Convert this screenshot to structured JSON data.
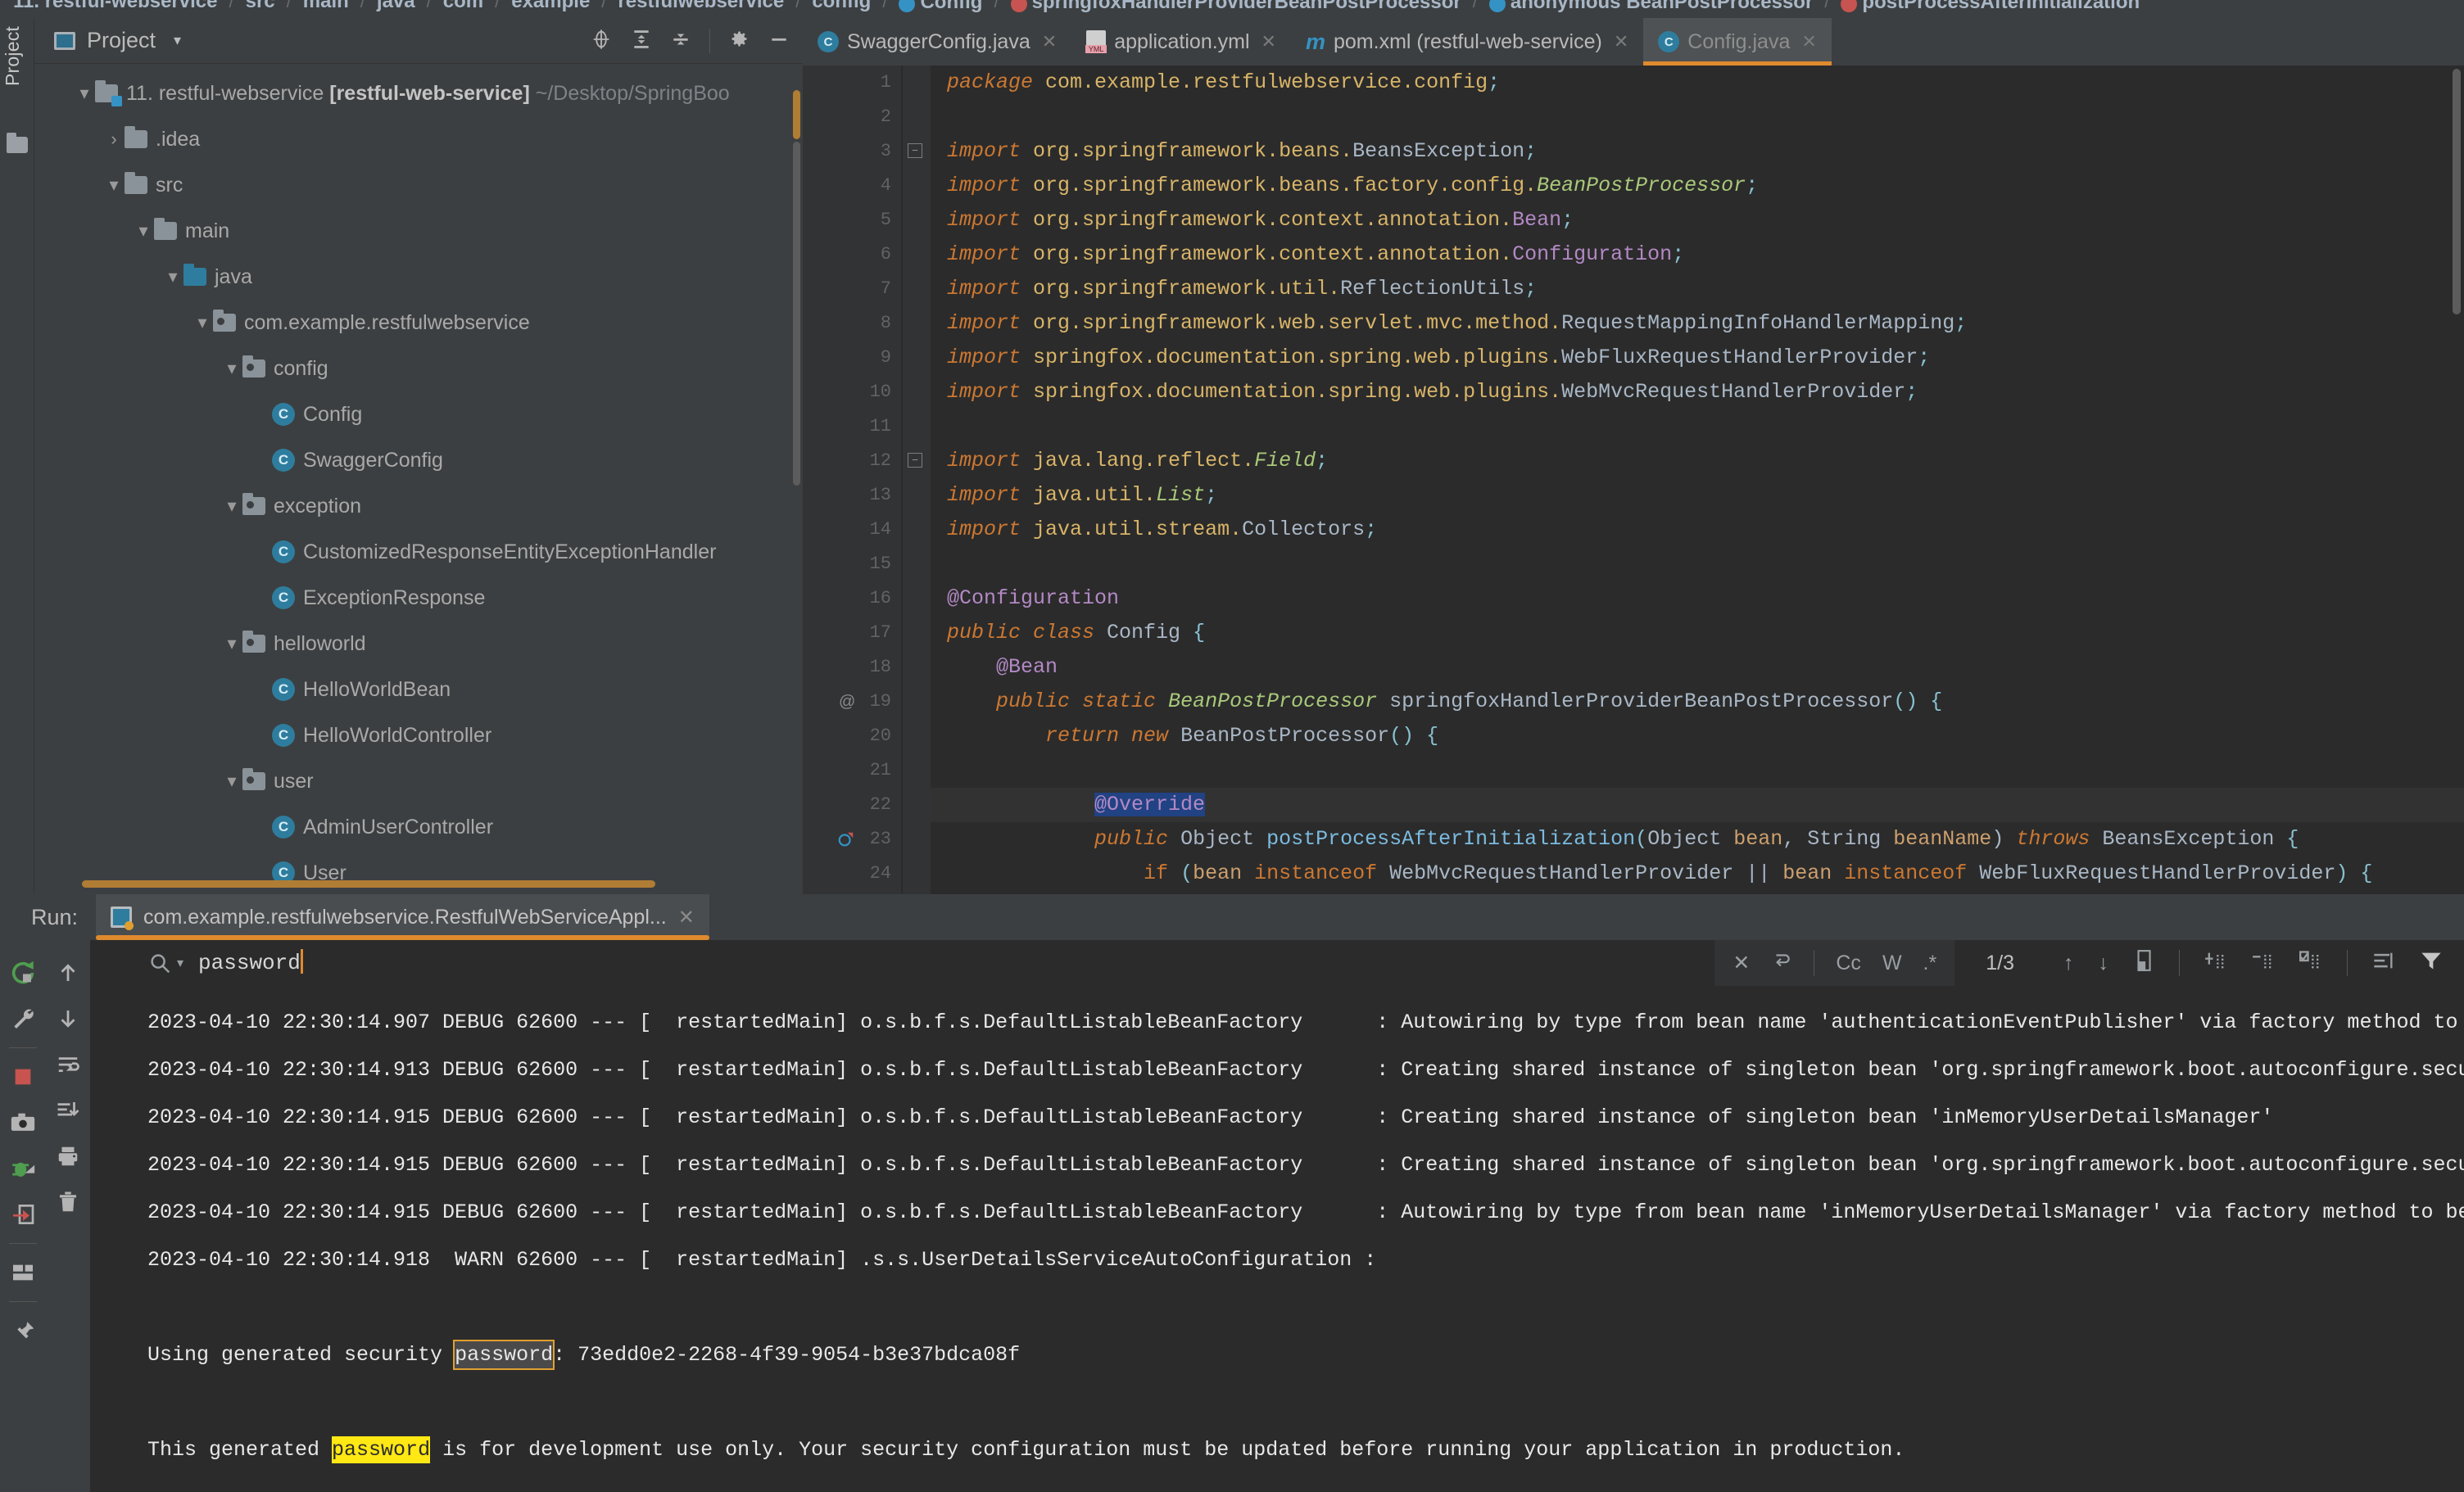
{
  "breadcrumb": [
    {
      "label": "11. restful-webservice",
      "bold": true,
      "icon": null
    },
    {
      "label": "src",
      "bold": true,
      "icon": null
    },
    {
      "label": "main",
      "bold": true,
      "icon": null
    },
    {
      "label": "java",
      "bold": true,
      "icon": null
    },
    {
      "label": "com",
      "bold": true,
      "icon": null
    },
    {
      "label": "example",
      "bold": true,
      "icon": null
    },
    {
      "label": "restfulwebservice",
      "bold": true,
      "icon": null
    },
    {
      "label": "config",
      "bold": true,
      "icon": null
    },
    {
      "label": "Config",
      "bold": true,
      "icon": "class-icon-blue"
    },
    {
      "label": "springfoxHandlerProviderBeanPostProcessor",
      "bold": true,
      "icon": "method-icon-red"
    },
    {
      "label": "anonymous BeanPostProcessor",
      "bold": true,
      "icon": "class-icon-blue"
    },
    {
      "label": "postProcessAfterInitialization",
      "bold": true,
      "icon": "method-icon-red"
    }
  ],
  "tool_strip": {
    "label": "Project",
    "folder_icon": "folder-icon"
  },
  "project_panel": {
    "title": "Project",
    "chevron": "▾",
    "toolbar_icons": [
      "locate-icon",
      "expand-all-icon",
      "collapse-all-icon",
      "gear-icon",
      "minimize-icon"
    ],
    "tree": [
      {
        "indent": 0,
        "twisty": "▾",
        "icon": "module-folder-icon",
        "label": "11. restful-webservice ",
        "bold": "[restful-web-service]",
        "dim": " ~/Desktop/SpringBoo"
      },
      {
        "indent": 1,
        "twisty": "›",
        "icon": "folder-icon",
        "label": ".idea"
      },
      {
        "indent": 1,
        "twisty": "▾",
        "icon": "folder-icon",
        "label": "src"
      },
      {
        "indent": 2,
        "twisty": "▾",
        "icon": "folder-icon",
        "label": "main"
      },
      {
        "indent": 3,
        "twisty": "▾",
        "icon": "source-folder-icon",
        "label": "java"
      },
      {
        "indent": 4,
        "twisty": "▾",
        "icon": "package-icon",
        "label": "com.example.restfulwebservice"
      },
      {
        "indent": 5,
        "twisty": "▾",
        "icon": "package-icon",
        "label": "config"
      },
      {
        "indent": 6,
        "twisty": "",
        "icon": "class-icon",
        "label": "Config"
      },
      {
        "indent": 6,
        "twisty": "",
        "icon": "class-icon",
        "label": "SwaggerConfig"
      },
      {
        "indent": 5,
        "twisty": "▾",
        "icon": "package-icon",
        "label": "exception"
      },
      {
        "indent": 6,
        "twisty": "",
        "icon": "class-icon",
        "label": "CustomizedResponseEntityExceptionHandler"
      },
      {
        "indent": 6,
        "twisty": "",
        "icon": "class-icon",
        "label": "ExceptionResponse"
      },
      {
        "indent": 5,
        "twisty": "▾",
        "icon": "package-icon",
        "label": "helloworld"
      },
      {
        "indent": 6,
        "twisty": "",
        "icon": "class-icon",
        "label": "HelloWorldBean"
      },
      {
        "indent": 6,
        "twisty": "",
        "icon": "class-icon",
        "label": "HelloWorldController"
      },
      {
        "indent": 5,
        "twisty": "▾",
        "icon": "package-icon",
        "label": "user"
      },
      {
        "indent": 6,
        "twisty": "",
        "icon": "class-icon",
        "label": "AdminUserController"
      },
      {
        "indent": 6,
        "twisty": "",
        "icon": "class-icon",
        "label": "User"
      }
    ]
  },
  "editor": {
    "tabs": [
      {
        "label": "SwaggerConfig.java",
        "icon": "java-class-icon",
        "active": false,
        "close": "✕"
      },
      {
        "label": "application.yml",
        "icon": "yml-file-icon",
        "active": false,
        "close": "✕"
      },
      {
        "label": "pom.xml (restful-web-service)",
        "icon": "maven-icon",
        "active": false,
        "close": "✕"
      },
      {
        "label": "Config.java",
        "icon": "java-class-icon",
        "active": true,
        "close": "✕"
      }
    ],
    "code": [
      {
        "n": 1,
        "tokens": [
          [
            "kw",
            "package "
          ],
          [
            "pkgc",
            "com.example.restfulwebservice.config"
          ],
          [
            "brace",
            ";"
          ]
        ]
      },
      {
        "n": 2,
        "tokens": []
      },
      {
        "n": 3,
        "tokens": [
          [
            "kw",
            "import "
          ],
          [
            "pkgc",
            "org.springframework.beans."
          ],
          [
            "type2",
            "BeansException"
          ],
          [
            "brace",
            ";"
          ]
        ],
        "fold": true
      },
      {
        "n": 4,
        "tokens": [
          [
            "kw",
            "import "
          ],
          [
            "pkgc",
            "org.springframework.beans.factory.config."
          ],
          [
            "type",
            "BeanPostProcessor"
          ],
          [
            "brace",
            ";"
          ]
        ]
      },
      {
        "n": 5,
        "tokens": [
          [
            "kw",
            "import "
          ],
          [
            "pkgc",
            "org.springframework.context.annotation."
          ],
          [
            "annp",
            "Bean"
          ],
          [
            "brace",
            ";"
          ]
        ]
      },
      {
        "n": 6,
        "tokens": [
          [
            "kw",
            "import "
          ],
          [
            "pkgc",
            "org.springframework.context.annotation."
          ],
          [
            "annp",
            "Configuration"
          ],
          [
            "brace",
            ";"
          ]
        ]
      },
      {
        "n": 7,
        "tokens": [
          [
            "kw",
            "import "
          ],
          [
            "pkgc",
            "org.springframework.util."
          ],
          [
            "type2",
            "ReflectionUtils"
          ],
          [
            "brace",
            ";"
          ]
        ]
      },
      {
        "n": 8,
        "tokens": [
          [
            "kw",
            "import "
          ],
          [
            "pkgc",
            "org.springframework.web.servlet.mvc.method."
          ],
          [
            "type2",
            "RequestMappingInfoHandlerMapping"
          ],
          [
            "brace",
            ";"
          ]
        ]
      },
      {
        "n": 9,
        "tokens": [
          [
            "kw",
            "import "
          ],
          [
            "pkgc",
            "springfox.documentation.spring.web.plugins."
          ],
          [
            "type2",
            "WebFluxRequestHandlerProvider"
          ],
          [
            "brace",
            ";"
          ]
        ]
      },
      {
        "n": 10,
        "tokens": [
          [
            "kw",
            "import "
          ],
          [
            "pkgc",
            "springfox.documentation.spring.web.plugins."
          ],
          [
            "type2",
            "WebMvcRequestHandlerProvider"
          ],
          [
            "brace",
            ";"
          ]
        ]
      },
      {
        "n": 11,
        "tokens": []
      },
      {
        "n": 12,
        "tokens": [
          [
            "kw",
            "import "
          ],
          [
            "pkgc",
            "java.lang.reflect."
          ],
          [
            "type",
            "Field"
          ],
          [
            "brace",
            ";"
          ]
        ],
        "fold": true
      },
      {
        "n": 13,
        "tokens": [
          [
            "kw",
            "import "
          ],
          [
            "pkgc",
            "java.util."
          ],
          [
            "type",
            "List"
          ],
          [
            "brace",
            ";"
          ]
        ]
      },
      {
        "n": 14,
        "tokens": [
          [
            "kw",
            "import "
          ],
          [
            "pkgc",
            "java.util.stream."
          ],
          [
            "type2",
            "Collectors"
          ],
          [
            "brace",
            ";"
          ]
        ]
      },
      {
        "n": 15,
        "tokens": []
      },
      {
        "n": 16,
        "tokens": [
          [
            "annp",
            "@Configuration"
          ]
        ]
      },
      {
        "n": 17,
        "tokens": [
          [
            "kw",
            "public class "
          ],
          [
            "ident",
            "Config "
          ],
          [
            "brace",
            "{"
          ]
        ]
      },
      {
        "n": 18,
        "tokens": [
          [
            "ident",
            "    "
          ],
          [
            "annp",
            "@Bean"
          ]
        ]
      },
      {
        "n": 19,
        "tokens": [
          [
            "ident",
            "    "
          ],
          [
            "kw",
            "public static "
          ],
          [
            "type",
            "BeanPostProcessor "
          ],
          [
            "ident",
            "springfoxHandlerProviderBeanPostProcessor"
          ],
          [
            "brace",
            "() {"
          ]
        ],
        "gutter_at": "@"
      },
      {
        "n": 20,
        "tokens": [
          [
            "ident",
            "        "
          ],
          [
            "kw",
            "return new "
          ],
          [
            "type2",
            "BeanPostProcessor"
          ],
          [
            "brace",
            "() {"
          ]
        ]
      },
      {
        "n": 21,
        "tokens": []
      },
      {
        "n": 22,
        "tokens": [
          [
            "ident",
            "            "
          ],
          [
            "annp hl-ov",
            "@Override"
          ]
        ],
        "current": true
      },
      {
        "n": 23,
        "tokens": [
          [
            "ident",
            "            "
          ],
          [
            "kw",
            "public "
          ],
          [
            "type2",
            "Object "
          ],
          [
            "meth",
            "postProcessAfterInitialization"
          ],
          [
            "brace",
            "("
          ],
          [
            "type2",
            "Object "
          ],
          [
            "param",
            "bean"
          ],
          [
            "punc",
            ", "
          ],
          [
            "type2",
            "String "
          ],
          [
            "param",
            "beanName"
          ],
          [
            "punc",
            ") "
          ],
          [
            "kw",
            "throws "
          ],
          [
            "type2",
            "BeansException "
          ],
          [
            "brace",
            "{"
          ]
        ],
        "gutter_bp": true
      },
      {
        "n": 24,
        "tokens": [
          [
            "ident",
            "                "
          ],
          [
            "kw2",
            "if "
          ],
          [
            "brace",
            "("
          ],
          [
            "param",
            "bean "
          ],
          [
            "kw2",
            "instanceof "
          ],
          [
            "type2",
            "WebMvcRequestHandlerProvider "
          ],
          [
            "punc",
            "|| "
          ],
          [
            "param",
            "bean "
          ],
          [
            "kw2",
            "instanceof "
          ],
          [
            "type2",
            "WebFluxRequestHandlerProvider"
          ],
          [
            "brace",
            ") {"
          ]
        ]
      }
    ]
  },
  "run_panel": {
    "label": "Run:",
    "tab_name": "com.example.restfulwebservice.RestfulWebServiceAppl...",
    "tab_close": "✕",
    "gutter_icons_col1": [
      "rerun-icon",
      "wrench-icon",
      "stop-icon",
      "camera-icon",
      "debug-icon",
      "export-icon",
      "layout-icon",
      "pin-icon"
    ],
    "gutter_icons_col2": [
      "scroll-up-icon",
      "scroll-down-icon",
      "soft-wrap-icon",
      "scroll-to-end-icon",
      "print-icon",
      "trash-icon"
    ],
    "search": {
      "value": "password",
      "search_icon": "search-icon",
      "clear_icon": "✕",
      "wrap_icon": "wrap-around-icon",
      "case_label": "Cc",
      "word_label": "W",
      "regex_label": ".*",
      "match_count": "1/3",
      "prev_icon": "↑",
      "next_icon": "↓",
      "select_all_icon": "select-all-icon",
      "expand_icon": "expand-lines-icon",
      "collapse_icon": "collapse-lines-icon",
      "toggle_icon": "toggle-lines-icon",
      "wrap_lines_icon": "soft-wrap-icon",
      "filter_icon": "filter-icon"
    },
    "console_lines": [
      {
        "parts": [
          {
            "t": "2023-04-10 22:30:14.907 DEBUG 62600 --- [  restartedMain] o.s.b.f.s.DefaultListableBeanFactory      : Autowiring by type from bean name 'authenticationEventPublisher' via factory method to bean name"
          }
        ]
      },
      {
        "parts": [
          {
            "t": "2023-04-10 22:30:14.913 DEBUG 62600 --- [  restartedMain] o.s.b.f.s.DefaultListableBeanFactory      : Creating shared instance of singleton bean 'org.springframework.boot.autoconfigure.security.serv"
          }
        ]
      },
      {
        "parts": [
          {
            "t": "2023-04-10 22:30:14.915 DEBUG 62600 --- [  restartedMain] o.s.b.f.s.DefaultListableBeanFactory      : Creating shared instance of singleton bean 'inMemoryUserDetailsManager'"
          }
        ]
      },
      {
        "parts": [
          {
            "t": "2023-04-10 22:30:14.915 DEBUG 62600 --- [  restartedMain] o.s.b.f.s.DefaultListableBeanFactory      : Creating shared instance of singleton bean 'org.springframework.boot.autoconfigure.security.serv"
          }
        ]
      },
      {
        "parts": [
          {
            "t": "2023-04-10 22:30:14.915 DEBUG 62600 --- [  restartedMain] o.s.b.f.s.DefaultListableBeanFactory      : Autowiring by type from bean name 'inMemoryUserDetailsManager' via factory method to bean named"
          }
        ]
      },
      {
        "parts": [
          {
            "t": "2023-04-10 22:30:14.918  WARN 62600 --- [  restartedMain] .s.s.UserDetailsServiceAutoConfiguration : "
          }
        ]
      },
      {
        "parts": [
          {
            "t": ""
          }
        ]
      },
      {
        "parts": [
          {
            "t": "Using generated security "
          },
          {
            "t": "password",
            "mark": "current"
          },
          {
            "t": ": 73edd0e2-2268-4f39-9054-b3e37bdca08f"
          }
        ]
      },
      {
        "parts": [
          {
            "t": ""
          }
        ]
      },
      {
        "parts": [
          {
            "t": "This generated "
          },
          {
            "t": "password",
            "mark": "yellow"
          },
          {
            "t": " is for development use only. Your security configuration must be updated before running your application in production."
          }
        ]
      }
    ]
  },
  "colors": {
    "accent_orange": "#e08a2e",
    "panel_bg": "#3c3f41",
    "editor_bg": "#2b2b2b",
    "highlight_yellow": "#ffe814",
    "class_icon_blue": "#2e7d9e"
  }
}
